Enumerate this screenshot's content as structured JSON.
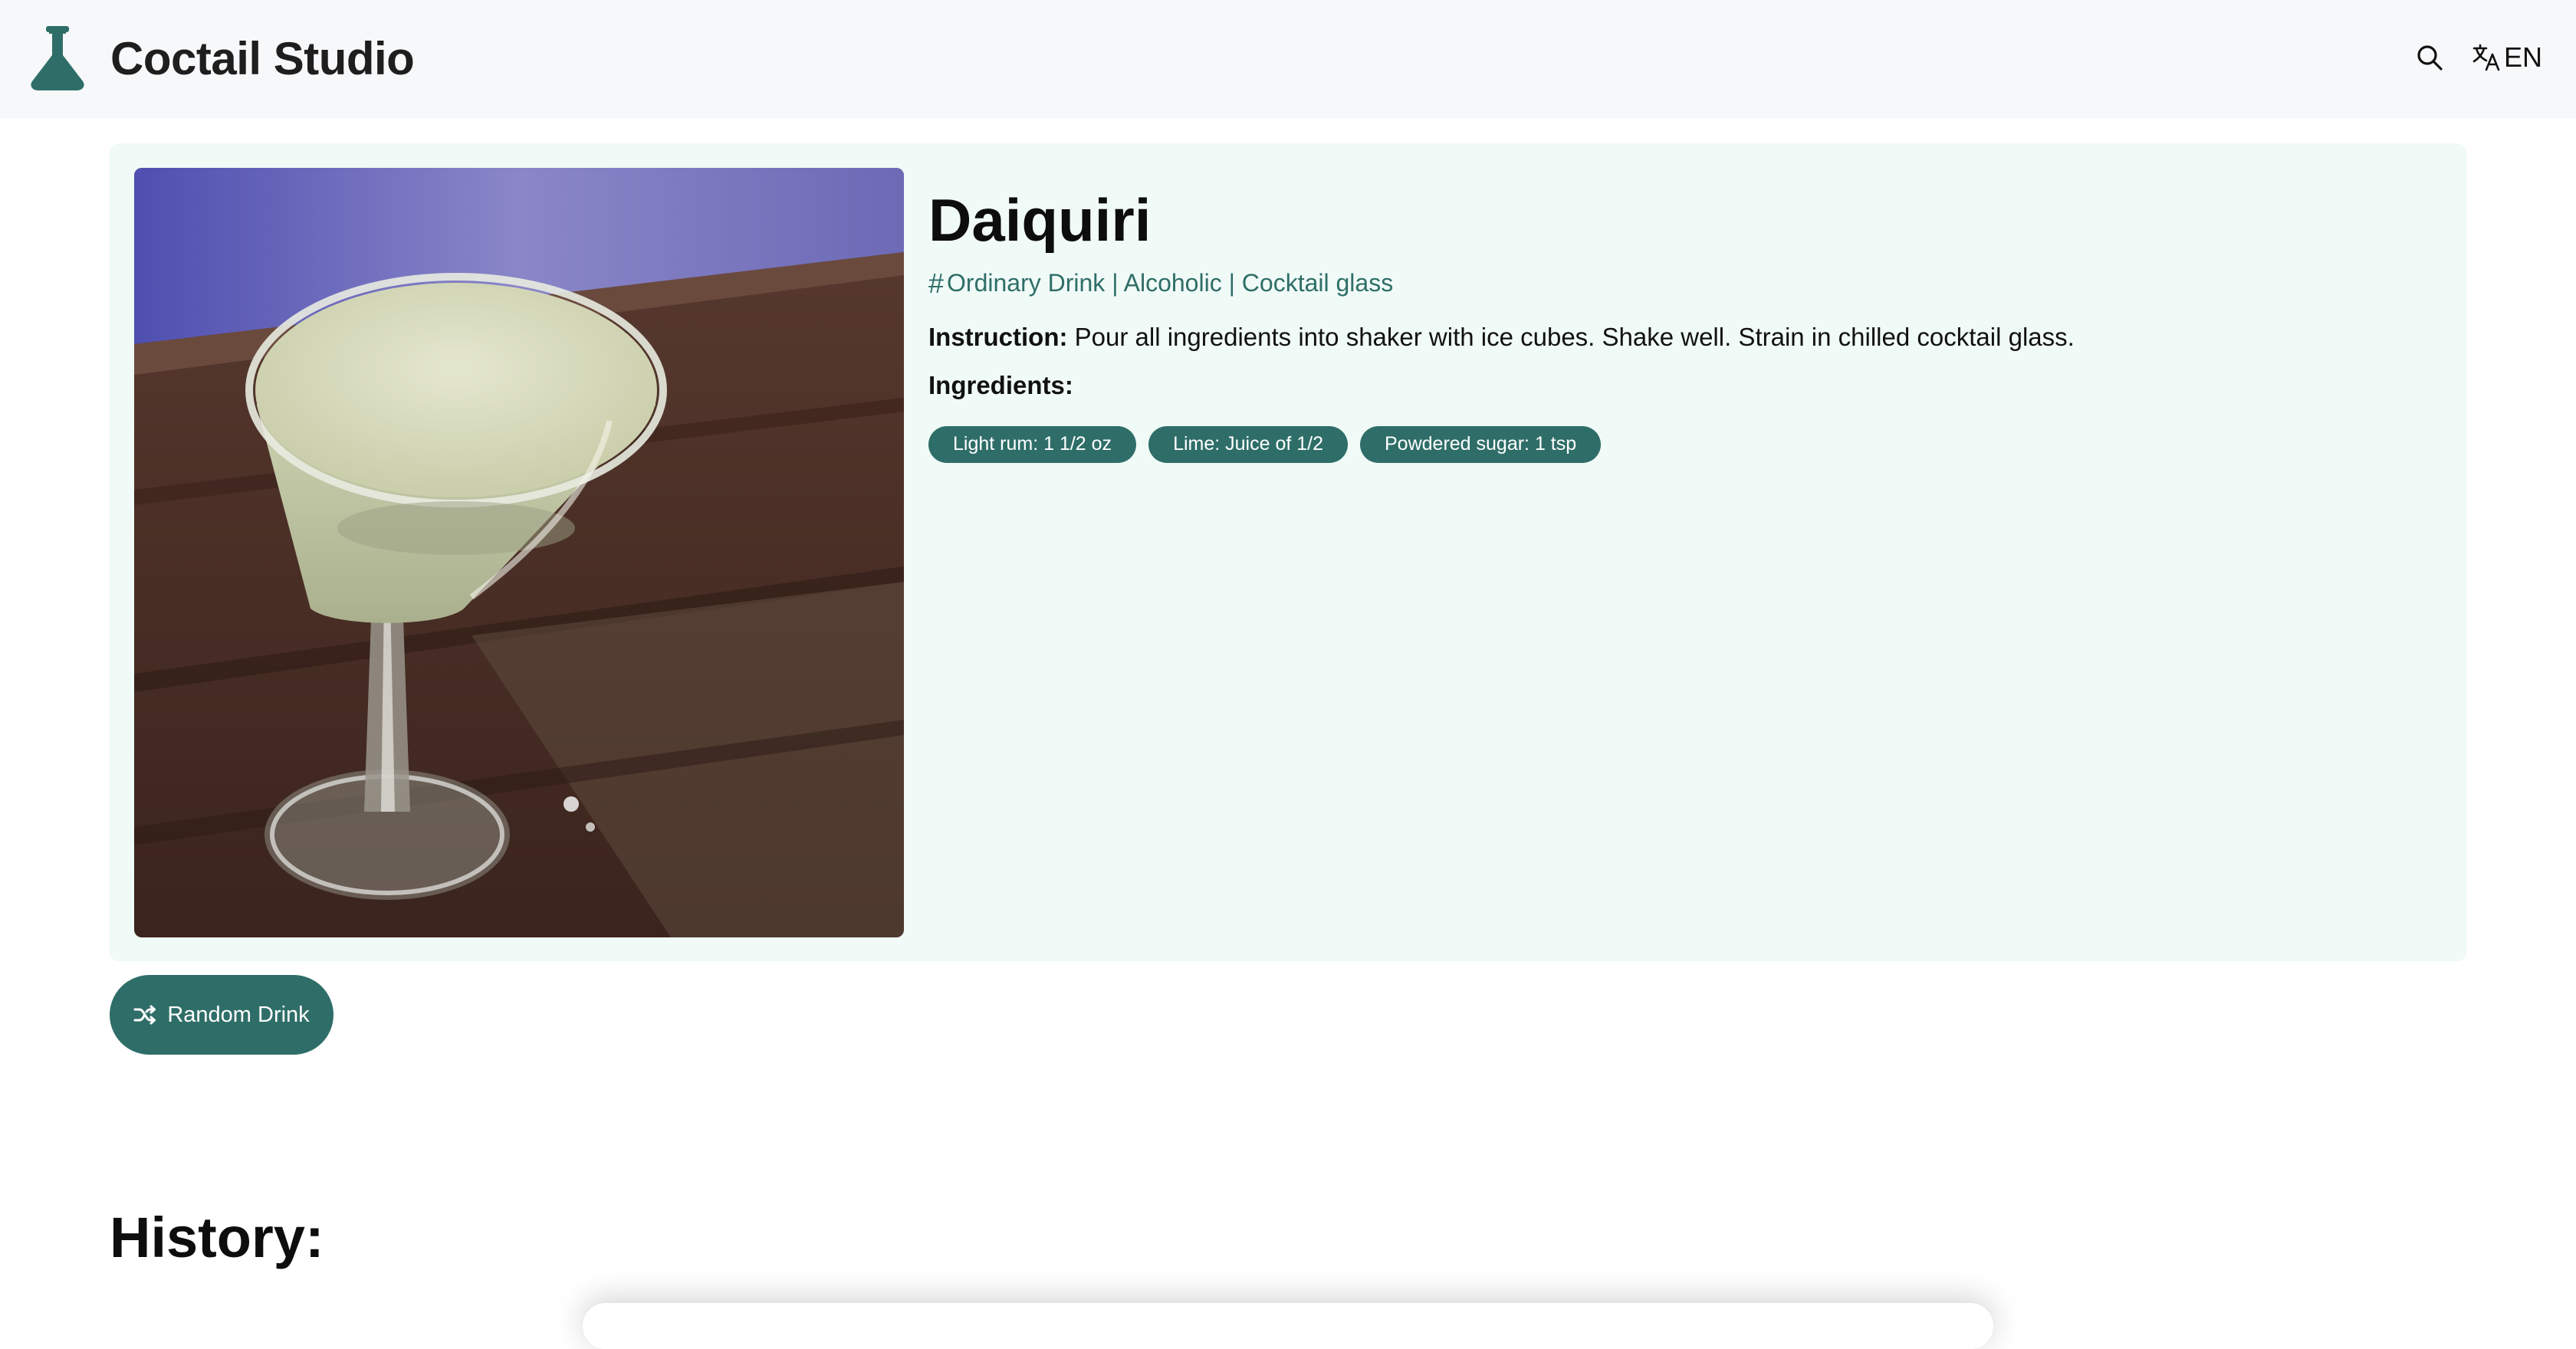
{
  "app": {
    "title": "Coctail Studio",
    "accent_color": "#2f6e68",
    "logo_icon": "flask-icon"
  },
  "header": {
    "search_icon": "search-icon",
    "language_icon": "translate-icon",
    "language_label": "EN"
  },
  "drink": {
    "name": "Daiquiri",
    "tags": "Ordinary Drink | Alcoholic | Cocktail glass",
    "tags_icon": "hash-icon",
    "instruction_label": "Instruction:",
    "instruction_text": " Pour all ingredients into shaker with ice cubes. Shake well. Strain in chilled cocktail glass.",
    "ingredients_label": "Ingredients:",
    "ingredients": [
      "Light rum: 1 1/2 oz",
      "Lime: Juice of 1/2",
      "Powdered sugar: 1 tsp"
    ],
    "photo_subject": "cocktail-glass-photo"
  },
  "actions": {
    "random_label": "Random Drink",
    "random_icon": "shuffle-icon"
  },
  "history": {
    "title": "History:"
  }
}
